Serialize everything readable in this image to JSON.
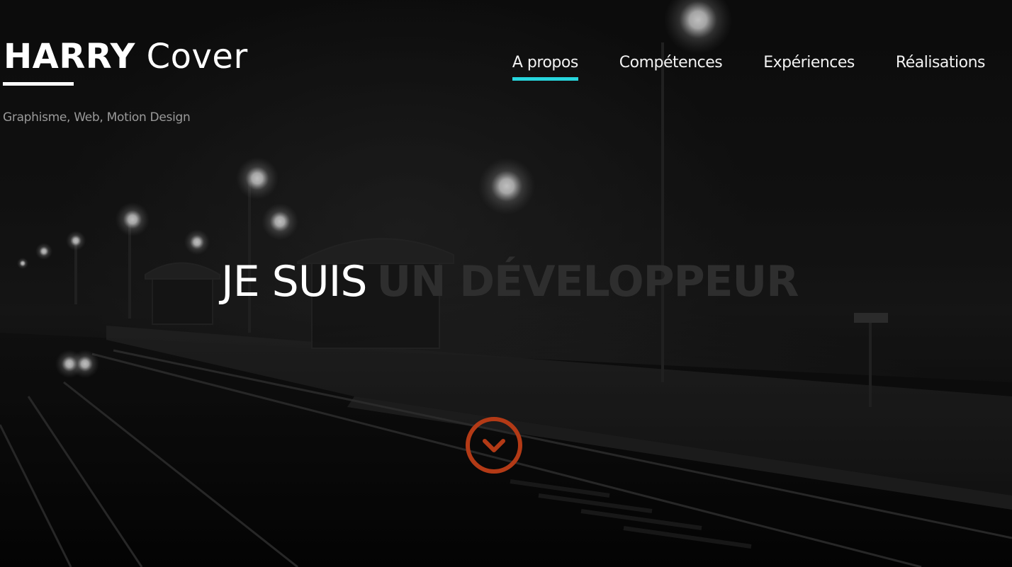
{
  "header": {
    "brand_first": "HARRY",
    "brand_last": "Cover",
    "tagline": "Graphisme, Web, Motion Design"
  },
  "nav": {
    "items": [
      {
        "label": "A propos",
        "active": true
      },
      {
        "label": "Compétences",
        "active": false
      },
      {
        "label": "Expériences",
        "active": false
      },
      {
        "label": "Réalisations",
        "active": false
      }
    ]
  },
  "hero": {
    "headline_static": "JE SUIS",
    "headline_rotating": "UN DÉVELOPPEUR",
    "scroll_icon": "chevron-down-circle-icon"
  },
  "colors": {
    "accent": "#27d6dd",
    "scroll_button": "#b33a16",
    "rotating_text": "#2e2e2e",
    "tagline": "#9a9a9a"
  }
}
